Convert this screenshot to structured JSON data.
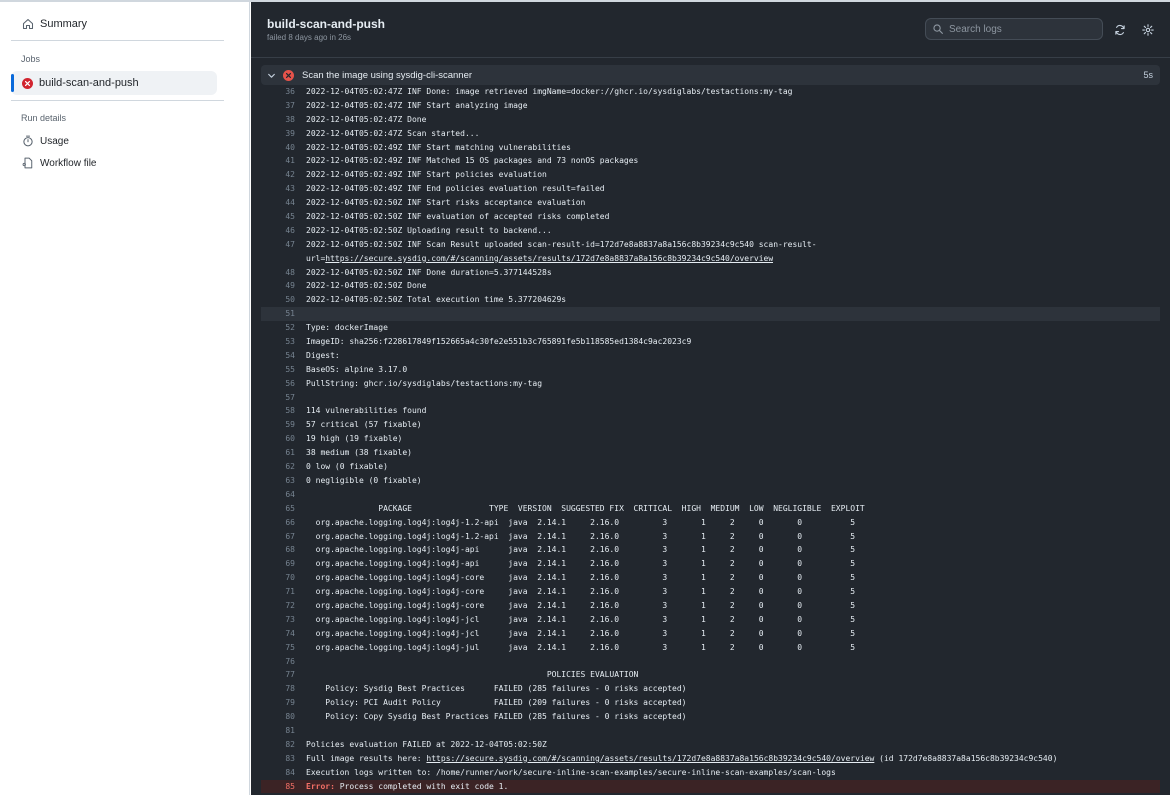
{
  "sidebar": {
    "summary_label": "Summary",
    "jobs_heading": "Jobs",
    "job_label": "build-scan-and-push",
    "run_details_heading": "Run details",
    "usage_label": "Usage",
    "workflow_label": "Workflow file"
  },
  "header": {
    "title": "build-scan-and-push",
    "subtitle": "failed 8 days ago in 26s",
    "search_placeholder": "Search logs"
  },
  "step": {
    "title": "Scan the image using sysdig-cli-scanner",
    "duration": "5s"
  },
  "log": {
    "lines": [
      {
        "n": "36",
        "t": "2022-12-04T05:02:47Z INF Done: image retrieved imgName=docker://ghcr.io/sysdiglabs/testactions:my-tag"
      },
      {
        "n": "37",
        "t": "2022-12-04T05:02:47Z INF Start analyzing image"
      },
      {
        "n": "38",
        "t": "2022-12-04T05:02:47Z Done"
      },
      {
        "n": "39",
        "t": "2022-12-04T05:02:47Z Scan started..."
      },
      {
        "n": "40",
        "t": "2022-12-04T05:02:49Z INF Start matching vulnerabilities"
      },
      {
        "n": "41",
        "t": "2022-12-04T05:02:49Z INF Matched 15 OS packages and 73 nonOS packages"
      },
      {
        "n": "42",
        "t": "2022-12-04T05:02:49Z INF Start policies evaluation"
      },
      {
        "n": "43",
        "t": "2022-12-04T05:02:49Z INF End policies evaluation result=failed"
      },
      {
        "n": "44",
        "t": "2022-12-04T05:02:50Z INF Start risks acceptance evaluation"
      },
      {
        "n": "45",
        "t": "2022-12-04T05:02:50Z INF evaluation of accepted risks completed"
      },
      {
        "n": "46",
        "t": "2022-12-04T05:02:50Z Uploading result to backend..."
      },
      {
        "n": "47",
        "t": "2022-12-04T05:02:50Z INF Scan Result uploaded scan-result-id=172d7e8a8837a8a156c8b39234c9c540 scan-result-"
      },
      {
        "n": "",
        "t": "url=",
        "link": "https://secure.sysdig.com/#/scanning/assets/results/172d7e8a8837a8a156c8b39234c9c540/overview"
      },
      {
        "n": "48",
        "t": "2022-12-04T05:02:50Z INF Done duration=5.377144528s"
      },
      {
        "n": "49",
        "t": "2022-12-04T05:02:50Z Done"
      },
      {
        "n": "50",
        "t": "2022-12-04T05:02:50Z Total execution time 5.377204629s"
      },
      {
        "n": "51",
        "t": "",
        "hl": true
      },
      {
        "n": "52",
        "t": "Type: dockerImage"
      },
      {
        "n": "53",
        "t": "ImageID: sha256:f228617849f152665a4c30fe2e551b3c765891fe5b118585ed1384c9ac2023c9"
      },
      {
        "n": "54",
        "t": "Digest:"
      },
      {
        "n": "55",
        "t": "BaseOS: alpine 3.17.0"
      },
      {
        "n": "56",
        "t": "PullString: ghcr.io/sysdiglabs/testactions:my-tag"
      },
      {
        "n": "57",
        "t": ""
      },
      {
        "n": "58",
        "t": "114 vulnerabilities found"
      },
      {
        "n": "59",
        "t": "57 critical (57 fixable)"
      },
      {
        "n": "60",
        "t": "19 high (19 fixable)"
      },
      {
        "n": "61",
        "t": "38 medium (38 fixable)"
      },
      {
        "n": "62",
        "t": "0 low (0 fixable)"
      },
      {
        "n": "63",
        "t": "0 negligible (0 fixable)"
      },
      {
        "n": "64",
        "t": ""
      },
      {
        "n": "65",
        "t": "               PACKAGE                TYPE  VERSION  SUGGESTED FIX  CRITICAL  HIGH  MEDIUM  LOW  NEGLIGIBLE  EXPLOIT"
      },
      {
        "n": "66",
        "t": "  org.apache.logging.log4j:log4j-1.2-api  java  2.14.1     2.16.0         3       1     2     0       0          5"
      },
      {
        "n": "67",
        "t": "  org.apache.logging.log4j:log4j-1.2-api  java  2.14.1     2.16.0         3       1     2     0       0          5"
      },
      {
        "n": "68",
        "t": "  org.apache.logging.log4j:log4j-api      java  2.14.1     2.16.0         3       1     2     0       0          5"
      },
      {
        "n": "69",
        "t": "  org.apache.logging.log4j:log4j-api      java  2.14.1     2.16.0         3       1     2     0       0          5"
      },
      {
        "n": "70",
        "t": "  org.apache.logging.log4j:log4j-core     java  2.14.1     2.16.0         3       1     2     0       0          5"
      },
      {
        "n": "71",
        "t": "  org.apache.logging.log4j:log4j-core     java  2.14.1     2.16.0         3       1     2     0       0          5"
      },
      {
        "n": "72",
        "t": "  org.apache.logging.log4j:log4j-core     java  2.14.1     2.16.0         3       1     2     0       0          5"
      },
      {
        "n": "73",
        "t": "  org.apache.logging.log4j:log4j-jcl      java  2.14.1     2.16.0         3       1     2     0       0          5"
      },
      {
        "n": "74",
        "t": "  org.apache.logging.log4j:log4j-jcl      java  2.14.1     2.16.0         3       1     2     0       0          5"
      },
      {
        "n": "75",
        "t": "  org.apache.logging.log4j:log4j-jul      java  2.14.1     2.16.0         3       1     2     0       0          5"
      },
      {
        "n": "76",
        "t": ""
      },
      {
        "n": "77",
        "t": "                                                  POLICIES EVALUATION"
      },
      {
        "n": "78",
        "t": "    Policy: Sysdig Best Practices      FAILED (285 failures - 0 risks accepted)"
      },
      {
        "n": "79",
        "t": "    Policy: PCI Audit Policy           FAILED (209 failures - 0 risks accepted)"
      },
      {
        "n": "80",
        "t": "    Policy: Copy Sysdig Best Practices FAILED (285 failures - 0 risks accepted)"
      },
      {
        "n": "81",
        "t": ""
      },
      {
        "n": "82",
        "t": "Policies evaluation FAILED at 2022-12-04T05:02:50Z"
      },
      {
        "n": "83",
        "t": "Full image results here: ",
        "link": "https://secure.sysdig.com/#/scanning/assets/results/172d7e8a8837a8a156c8b39234c9c540/overview",
        "after": " (id 172d7e8a8837a8a156c8b39234c9c540)"
      },
      {
        "n": "84",
        "t": "Execution logs written to: /home/runner/work/secure-inline-scan-examples/secure-inline-scan-examples/scan-logs"
      },
      {
        "n": "85",
        "label": "Error:",
        "t": " Process completed with exit code 1.",
        "err": true
      }
    ]
  }
}
